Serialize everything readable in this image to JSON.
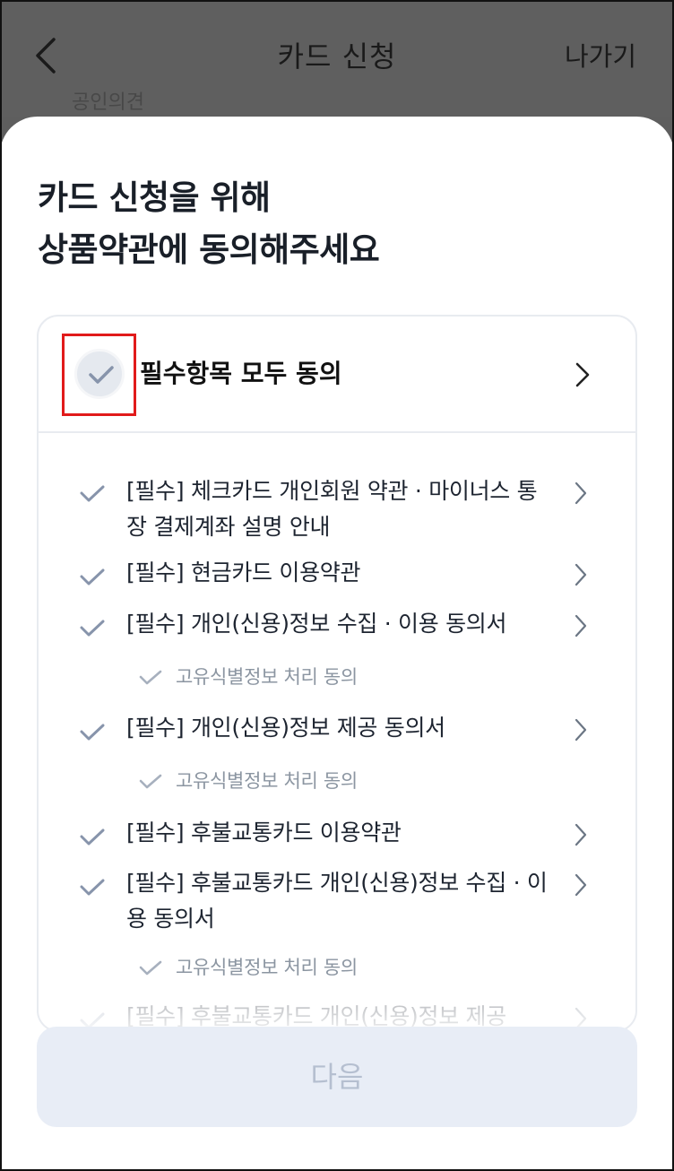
{
  "header": {
    "title": "카드 신청",
    "exit_label": "나가기",
    "behind_text": "공인의견"
  },
  "sheet": {
    "heading_line1": "카드 신청을 위해",
    "heading_line2": "상품약관에 동의해주세요",
    "agree_all_label": "필수항목 모두 동의",
    "items": [
      {
        "label": "[필수] 체크카드 개인회원 약관 · 마이너스 통장 결제계좌 설명 안내"
      },
      {
        "label": "[필수] 현금카드 이용약관"
      },
      {
        "label": "[필수] 개인(신용)정보 수집 · 이용 동의서",
        "sub": "고유식별정보 처리 동의"
      },
      {
        "label": "[필수] 개인(신용)정보 제공 동의서",
        "sub": "고유식별정보 처리 동의"
      },
      {
        "label": "[필수] 후불교통카드 이용약관"
      },
      {
        "label": "[필수] 후불교통카드 개인(신용)정보 수집 · 이용 동의서",
        "sub": "고유식별정보 처리 동의"
      },
      {
        "label": "[필수] 후불교통카드 개인(신용)정보 제공"
      }
    ],
    "next_label": "다음"
  },
  "colors": {
    "sheet_bg": "#ffffff",
    "overlay": "#5e5e5e",
    "check": "#8794ab",
    "highlight": "#e11b1b",
    "button_bg": "#e8edf6",
    "button_text": "#b5bfd0"
  },
  "icons": {
    "back": "chevron-left-icon",
    "check": "check-icon",
    "row_arrow": "chevron-right-icon"
  }
}
